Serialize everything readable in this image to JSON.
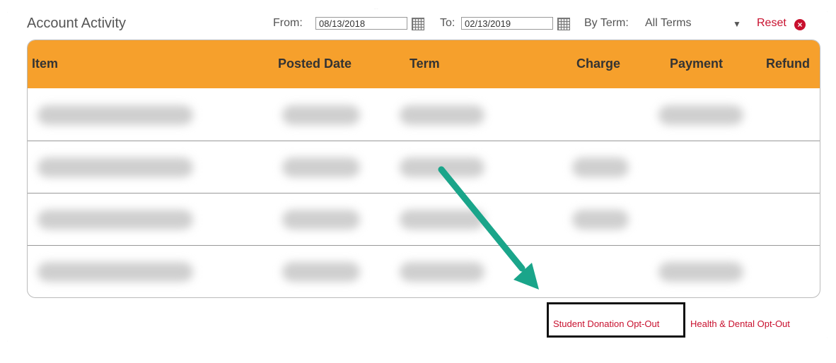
{
  "header": {
    "title": "Account Activity",
    "from_label": "From:",
    "from_value": "08/13/2018",
    "to_label": "To:",
    "to_value": "02/13/2019",
    "term_label": "By Term:",
    "term_value": "All Terms",
    "reset_label": "Reset",
    "reset_icon": "×"
  },
  "table": {
    "columns": [
      "Item",
      "Posted Date",
      "Term",
      "Charge",
      "Payment",
      "Refund"
    ]
  },
  "links": {
    "student_donation": "Student Donation Opt-Out",
    "health_dental": "Health & Dental Opt-Out"
  },
  "colors": {
    "header_bg": "#f6a02c",
    "link": "#c8102e",
    "arrow": "#1aa58a"
  },
  "icons": {
    "calendar": "calendar-icon",
    "reset": "close-circle-icon",
    "dropdown": "chevron-down-icon",
    "annotation": "arrow-icon"
  }
}
